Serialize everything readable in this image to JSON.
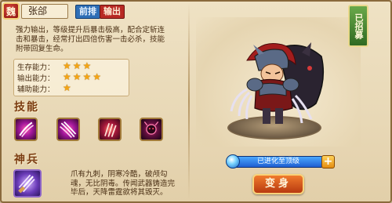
{
  "header": {
    "faction": "魏",
    "hero_name": "张郃",
    "tag_front": "前排",
    "tag_dps": "输出"
  },
  "description": "强力输出，等级提升后暴击极高，配合定斩连击和暴击，经常打出四倍伤害一击必杀，技能附带回复生命。",
  "stats": [
    {
      "label": "生存能力：",
      "stars": 3
    },
    {
      "label": "输出能力：",
      "stars": 4
    },
    {
      "label": "辅助能力：",
      "stars": 1
    }
  ],
  "skills_title": "技能",
  "skills": [
    {
      "icon": "claw-slash-icon"
    },
    {
      "icon": "triple-claw-icon"
    },
    {
      "icon": "red-claw-icon"
    },
    {
      "icon": "dark-beast-icon"
    }
  ],
  "weapon_title": "神兵",
  "weapon": {
    "icon": "claw-weapon-icon",
    "desc": "爪有九刺，阴寒冷酷，破颅勾魂，无比阴毒。传闻武器铸造完毕后，天降雷霆欲将其毁灭。"
  },
  "right": {
    "recruit_badge": "已招募",
    "evolution": "已进化至顶级",
    "plus": "+",
    "transform_button": "变身"
  }
}
